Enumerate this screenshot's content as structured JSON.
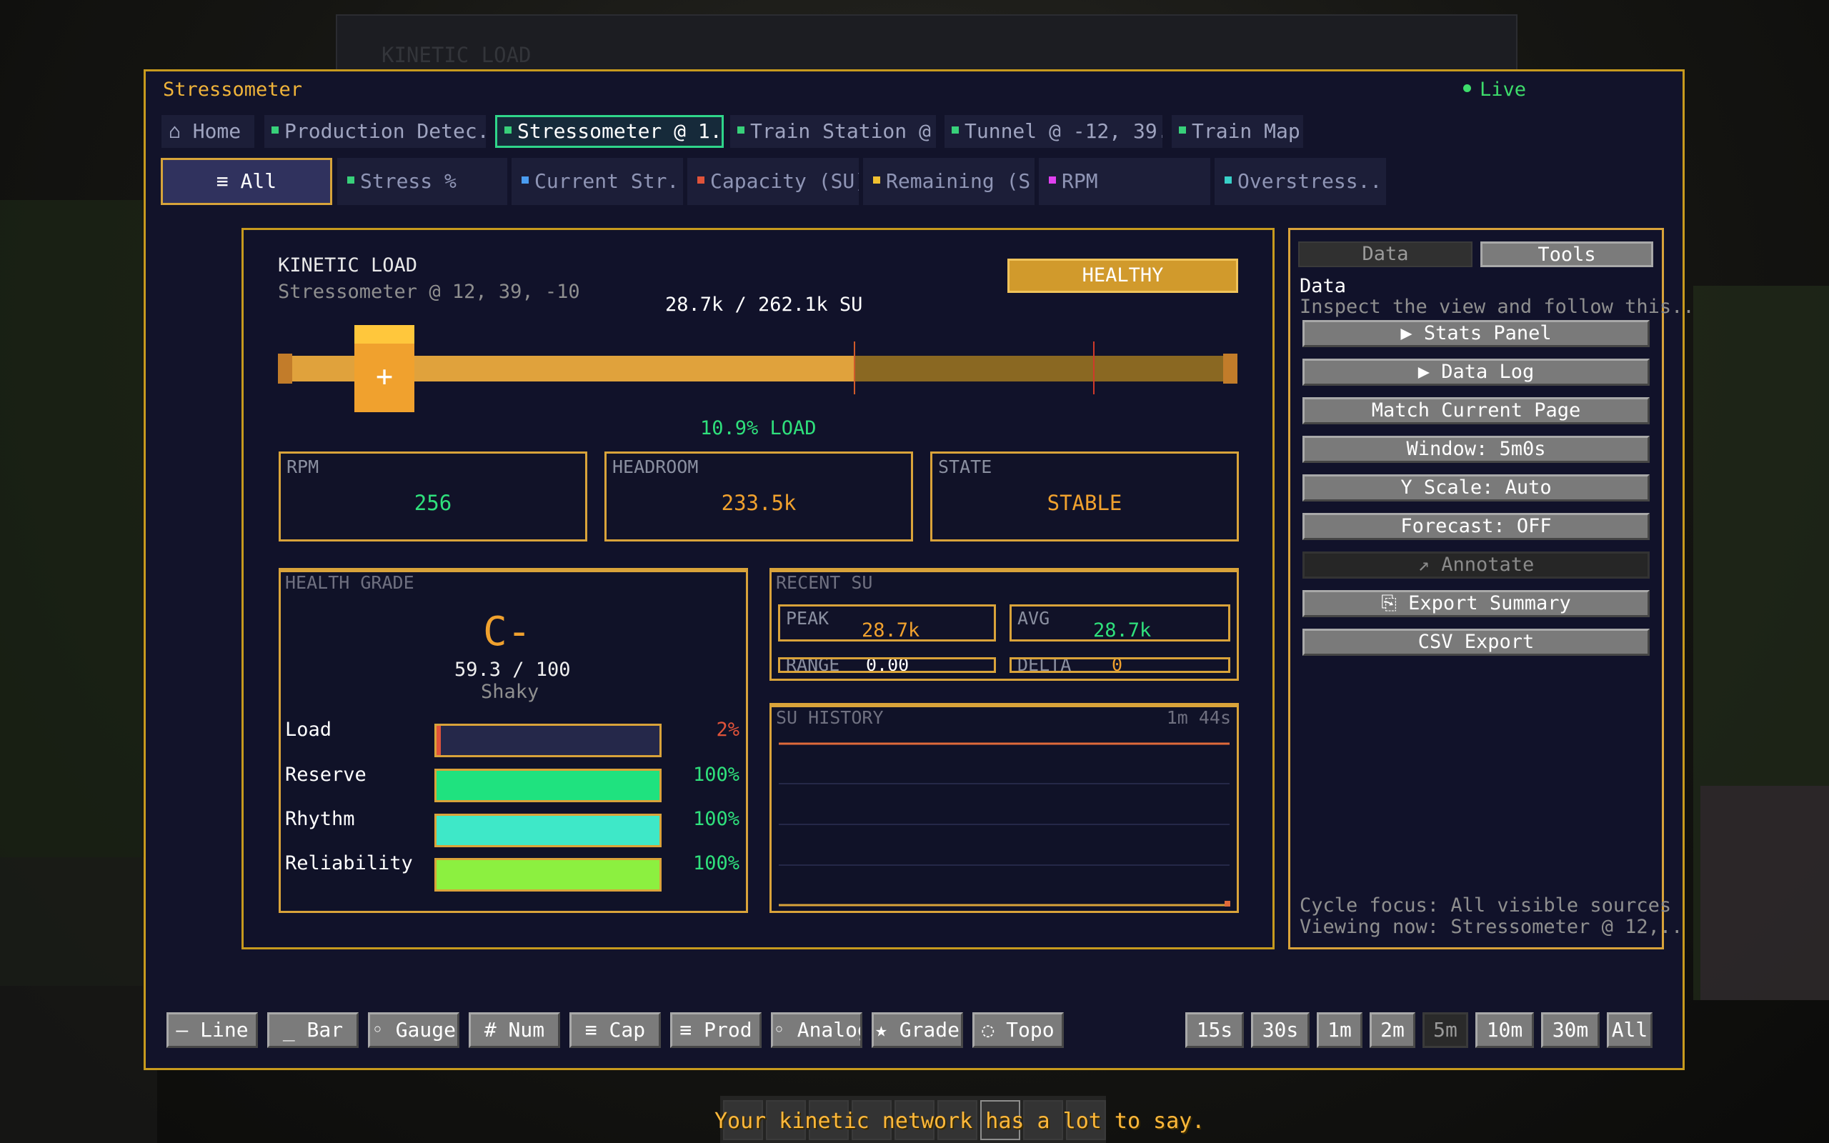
{
  "window": {
    "title": "Stressometer",
    "live_label": "Live"
  },
  "tabs": [
    {
      "label": "Home",
      "icon": "home-icon"
    },
    {
      "label": "Production Detec.."
    },
    {
      "label": "Stressometer @ 1.."
    },
    {
      "label": "Train Station @ .."
    },
    {
      "label": "Tunnel @ -12, 39.."
    },
    {
      "label": "Train Map"
    }
  ],
  "filters": [
    {
      "label": "≡ All",
      "color": "#ffffff"
    },
    {
      "label": "Stress %",
      "color": "#38d07a"
    },
    {
      "label": "Current Str..",
      "color": "#4a9cf0"
    },
    {
      "label": "Capacity (SU)",
      "color": "#e0533a"
    },
    {
      "label": "Remaining (S..",
      "color": "#f0c030"
    },
    {
      "label": "RPM",
      "color": "#e040f0"
    },
    {
      "label": "Overstress..",
      "color": "#38d0c8"
    }
  ],
  "main": {
    "title": "KINETIC LOAD",
    "subtitle": "Stressometer @ 12, 39, -10",
    "status_badge": "HEALTHY",
    "su_reading": "28.7k / 262.1k SU",
    "load_fraction": 0.109,
    "load_label": "10.9% LOAD",
    "thumb_glyph": "+",
    "stats": {
      "rpm_label": "RPM",
      "rpm_value": "256",
      "headroom_label": "HEADROOM",
      "headroom_value": "233.5k",
      "state_label": "STATE",
      "state_value": "STABLE"
    },
    "health": {
      "label": "HEALTH GRADE",
      "grade": "C-",
      "score": "59.3 / 100",
      "word": "Shaky",
      "bars": [
        {
          "label": "Load",
          "pct": "2%",
          "fraction": 0.02,
          "color": "#e0533a",
          "pct_color": "#e0533a"
        },
        {
          "label": "Reserve",
          "pct": "100%",
          "fraction": 1.0,
          "color": "#1fe27f",
          "pct_color": "#2fe07c"
        },
        {
          "label": "Rhythm",
          "pct": "100%",
          "fraction": 1.0,
          "color": "#3ee8c8",
          "pct_color": "#2fe07c"
        },
        {
          "label": "Reliability",
          "pct": "100%",
          "fraction": 1.0,
          "color": "#8cf040",
          "pct_color": "#2fe07c"
        }
      ]
    },
    "recent": {
      "label": "RECENT SU",
      "peak_label": "PEAK",
      "peak_value": "28.7k",
      "avg_label": "AVG",
      "avg_value": "28.7k",
      "range_label": "RANGE",
      "range_value": "0.00",
      "delta_label": "DELTA",
      "delta_value": "0"
    },
    "history": {
      "label": "SU HISTORY",
      "duration": "1m 44s"
    }
  },
  "sidebar": {
    "tab_data": "Data",
    "tab_tools": "Tools",
    "heading": "Data",
    "description": "Inspect the view and follow this..",
    "buttons": [
      "▶ Stats Panel",
      "▶ Data Log",
      "Match Current Page",
      "Window: 5m0s",
      "Y Scale: Auto",
      "Forecast: OFF",
      "↗ Annotate",
      "⎘ Export Summary",
      "CSV Export"
    ],
    "footer_1": "Cycle focus: All visible sources",
    "footer_2": "Viewing now: Stressometer @ 12,.."
  },
  "toolbar": {
    "views": [
      "— Line",
      "_ Bar",
      "◦ Gauge",
      "# Num",
      "≡ Cap",
      "≡ Prod",
      "◦ Analog",
      "★ Grade",
      "◌ Topo"
    ],
    "ranges": [
      "15s",
      "30s",
      "1m",
      "2m",
      "5m",
      "10m",
      "30m",
      "All"
    ],
    "selected_range": "5m"
  },
  "chat_message": "Your kinetic network has a lot to say."
}
